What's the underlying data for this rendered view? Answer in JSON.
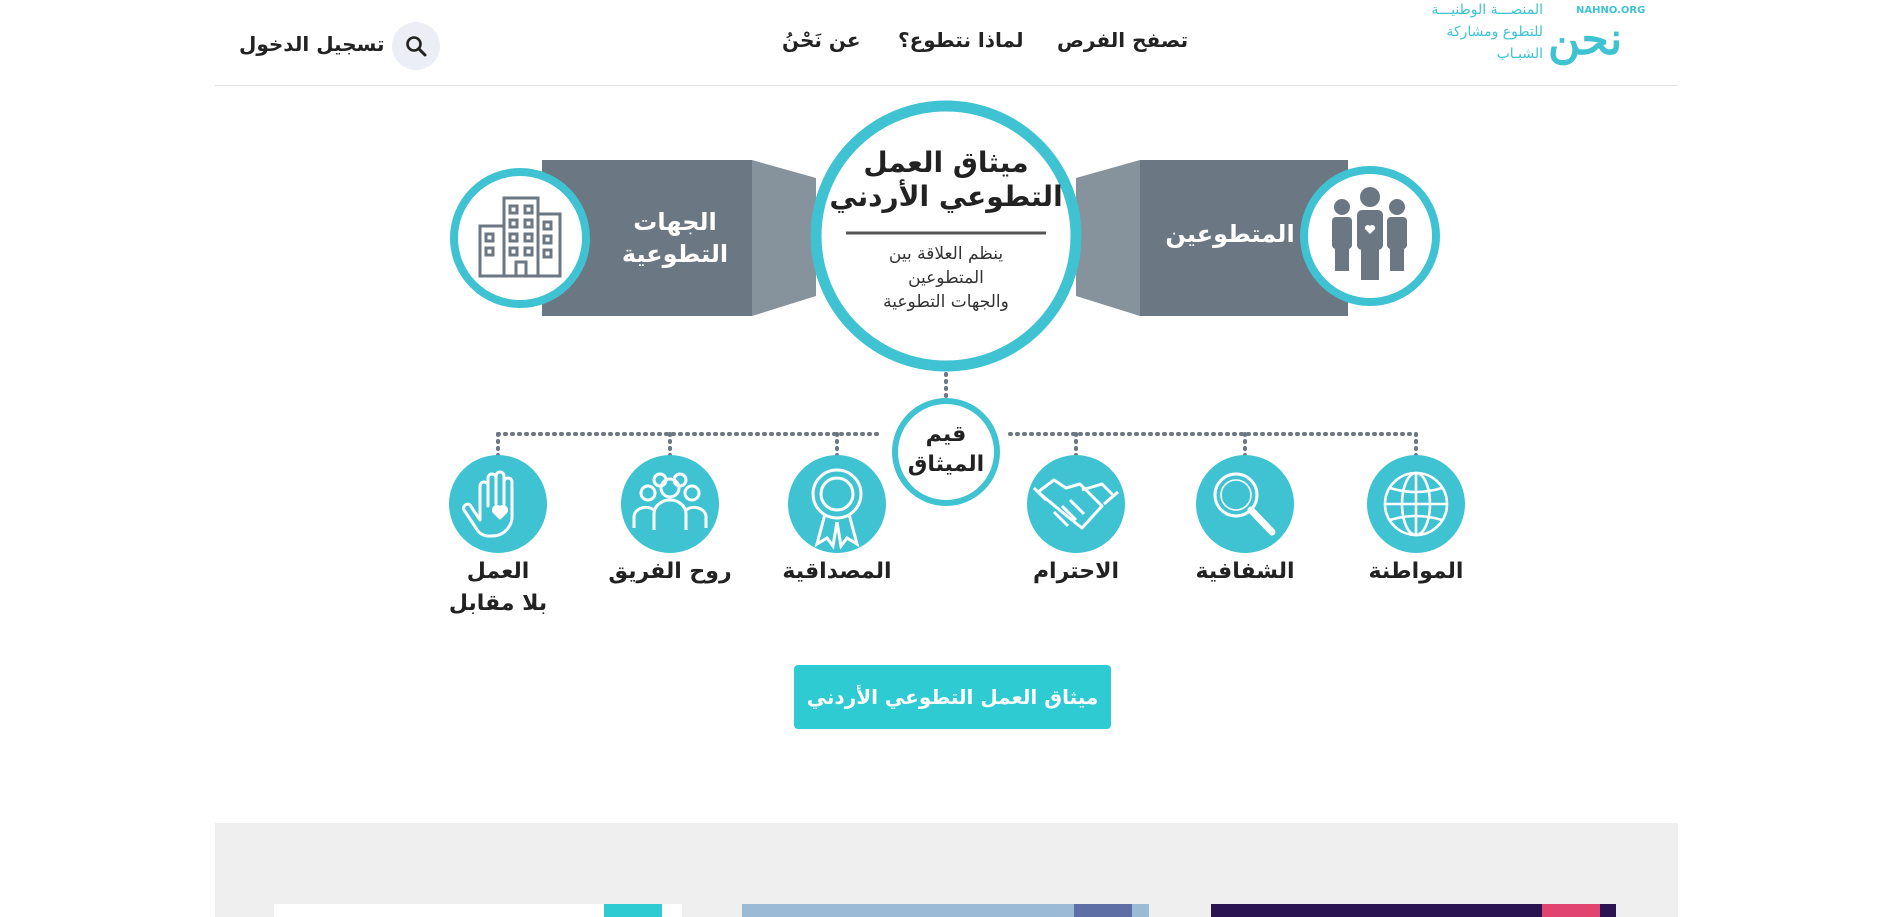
{
  "header": {
    "logo": {
      "domain": "NAHNO.ORG",
      "wordmark": "نحن",
      "tagline_lines": [
        "المنصـــة الوطنيـــة",
        "للتطوع ومشاركة",
        "الشبـاب"
      ]
    },
    "nav": [
      "تصفح الفرص",
      "لماذا نتطوع؟",
      "عن نَحْنُ"
    ],
    "search_icon": "search-icon",
    "login_label": "تسجيل الدخول"
  },
  "charter": {
    "center_title_lines": [
      "ميثاق العمل",
      "التطوعي الأردني"
    ],
    "center_subtitle_lines": [
      "ينظم العلاقة بين",
      "المتطوعين",
      "والجهات التطوعية"
    ],
    "right_label": "المتطوعين",
    "right_icon": "people-icon",
    "left_label_lines": [
      "الجهات",
      "التطوعية"
    ],
    "left_icon": "building-icon",
    "values_hub_lines": [
      "قيم",
      "الميثاق"
    ],
    "values": [
      {
        "label_lines": [
          "المواطنة"
        ],
        "icon": "globe-icon"
      },
      {
        "label_lines": [
          "الشفافية"
        ],
        "icon": "magnifier-icon"
      },
      {
        "label_lines": [
          "الاحترام"
        ],
        "icon": "handshake-icon"
      },
      {
        "label_lines": [
          "المصداقية"
        ],
        "icon": "award-ribbon-icon"
      },
      {
        "label_lines": [
          "روح الفريق"
        ],
        "icon": "team-icon"
      },
      {
        "label_lines": [
          "العمل",
          "بلا مقابل"
        ],
        "icon": "hand-heart-icon"
      }
    ]
  },
  "cta_label": "ميثاق العمل التطوعي الأردني",
  "colors": {
    "accent": "#3fc3d2",
    "cta": "#2fcbd3",
    "ribbon_dark": "#6b7782",
    "ribbon_light": "#86929c",
    "band": "#efefef",
    "card_purple": "#2a1552",
    "card_pink": "#e0446f",
    "card_blue": "#9bbad6",
    "card_indigo": "#5e6fa6",
    "card_teal": "#2fcbd3"
  }
}
